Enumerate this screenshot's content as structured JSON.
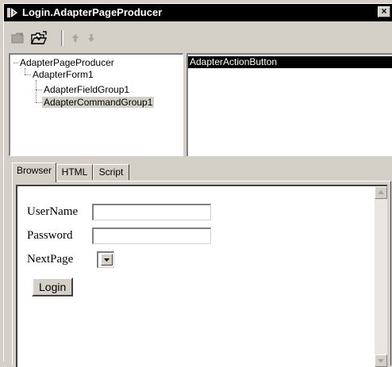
{
  "window": {
    "title": "Login.AdapterPageProducer",
    "close_glyph": "×"
  },
  "toolbar": {
    "buttons": [
      {
        "icon": "new-folder-icon",
        "enabled": false
      },
      {
        "icon": "open-folder-icon",
        "enabled": true
      },
      {
        "icon": "arrow-up-icon",
        "enabled": false
      },
      {
        "icon": "arrow-down-icon",
        "enabled": false
      }
    ]
  },
  "tree": {
    "items": [
      {
        "label": "AdapterPageProducer",
        "level": 0,
        "selected": false
      },
      {
        "label": "AdapterForm1",
        "level": 1,
        "selected": false
      },
      {
        "label": "AdapterFieldGroup1",
        "level": 2,
        "selected": false
      },
      {
        "label": "AdapterCommandGroup1",
        "level": 2,
        "selected": true
      }
    ]
  },
  "fields": {
    "items": [
      {
        "label": "AdapterActionButton",
        "selected": true
      }
    ]
  },
  "tabs": [
    {
      "label": "Browser",
      "active": true
    },
    {
      "label": "HTML",
      "active": false
    },
    {
      "label": "Script",
      "active": false
    }
  ],
  "form": {
    "username_label": "UserName",
    "username_value": "",
    "password_label": "Password",
    "password_value": "",
    "nextpage_label": "NextPage",
    "nextpage_value": "",
    "login_button": "Login"
  },
  "colors": {
    "face": "#d4d0c8",
    "titlebar": "#000000",
    "selection": "#000000",
    "selection_text": "#ffffff"
  }
}
